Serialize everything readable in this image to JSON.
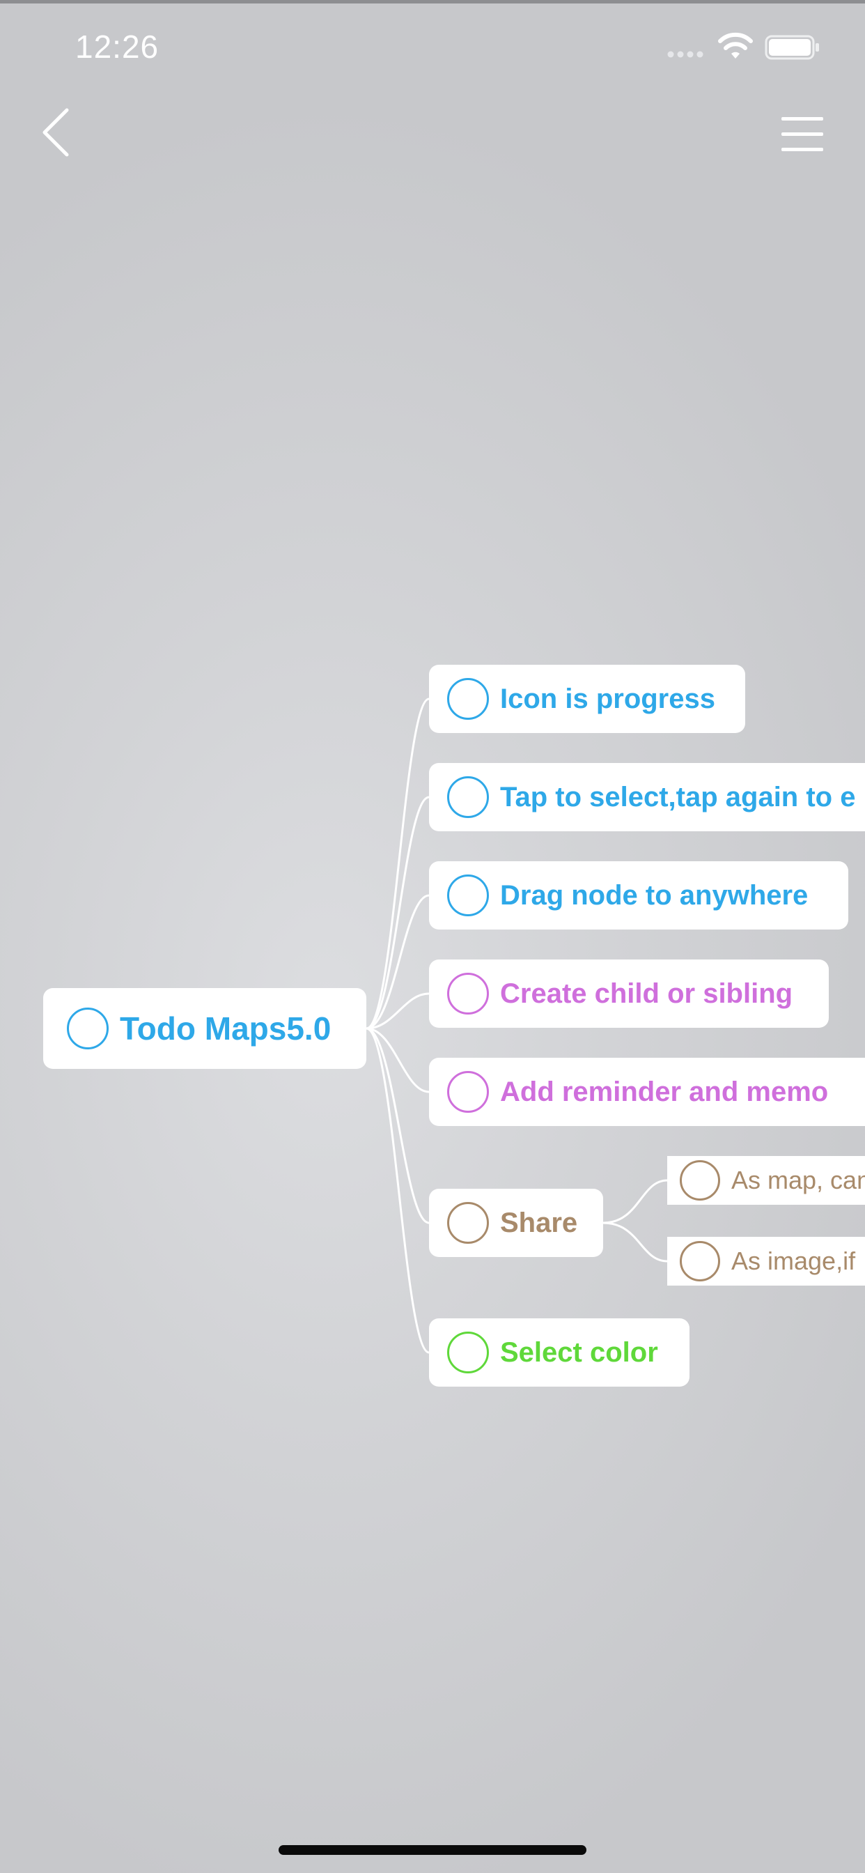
{
  "status_bar": {
    "time": "12:26"
  },
  "nav": {
    "back_icon": "chevron-left-icon",
    "menu_icon": "hamburger-menu-icon"
  },
  "mindmap": {
    "root": {
      "label": "Todo Maps5.0",
      "color": "#2ea8e8"
    },
    "branches": [
      {
        "label": "Icon is progress",
        "color": "#2ea8e8"
      },
      {
        "label": "Tap to select,tap again to e",
        "color": "#2ea8e8"
      },
      {
        "label": "Drag node to anywhere",
        "color": "#2ea8e8"
      },
      {
        "label": "Create child or sibling",
        "color": "#cf6fdc"
      },
      {
        "label": "Add reminder and memo",
        "color": "#cf6fdc"
      },
      {
        "label": "Share",
        "color": "#a88a6a"
      },
      {
        "label": "Select color",
        "color": "#5fd83a"
      }
    ],
    "share_children": [
      {
        "label": "As map, can",
        "color": "#a88a6a"
      },
      {
        "label": "As image,if",
        "color": "#a88a6a"
      }
    ]
  }
}
